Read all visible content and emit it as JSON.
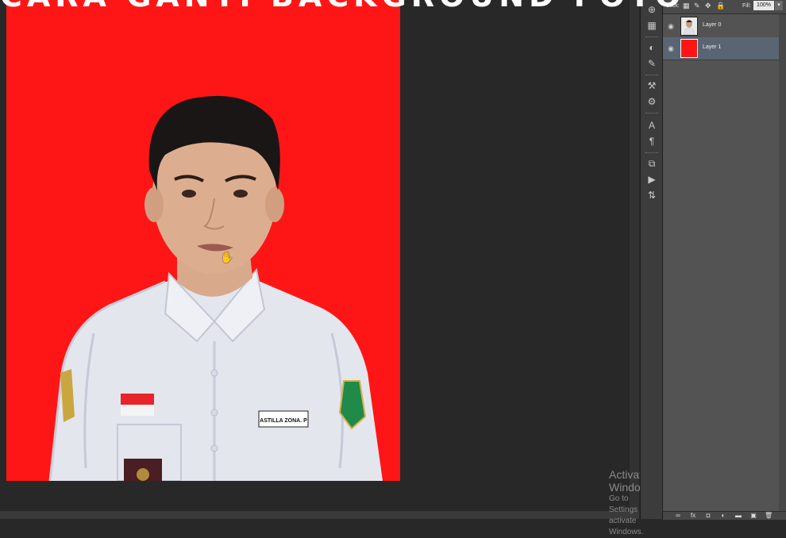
{
  "caption_text": "CARA GANTI BACKGROUND FOTO",
  "canvas": {
    "background_color": "#fe1616",
    "name_tag": "ASTILLA ZONA. P"
  },
  "layers_panel": {
    "lock_label": "Lock:",
    "fill_label": "Fill:",
    "fill_value": "100%",
    "layers": [
      {
        "name": "Layer 0",
        "thumbnail": "portrait-thumbnail",
        "selected": false
      },
      {
        "name": "Layer 1",
        "thumbnail": "red-fill-thumbnail",
        "selected": true
      }
    ]
  },
  "watermark": {
    "title": "Activate Windows",
    "subtitle": "Go to Settings to activate Windows."
  },
  "colors": {
    "workspace": "#282828",
    "panel": "#535353",
    "selected_layer": "#5a6573",
    "photo_background": "#fe1616",
    "shirt": "#e4e6ee"
  }
}
